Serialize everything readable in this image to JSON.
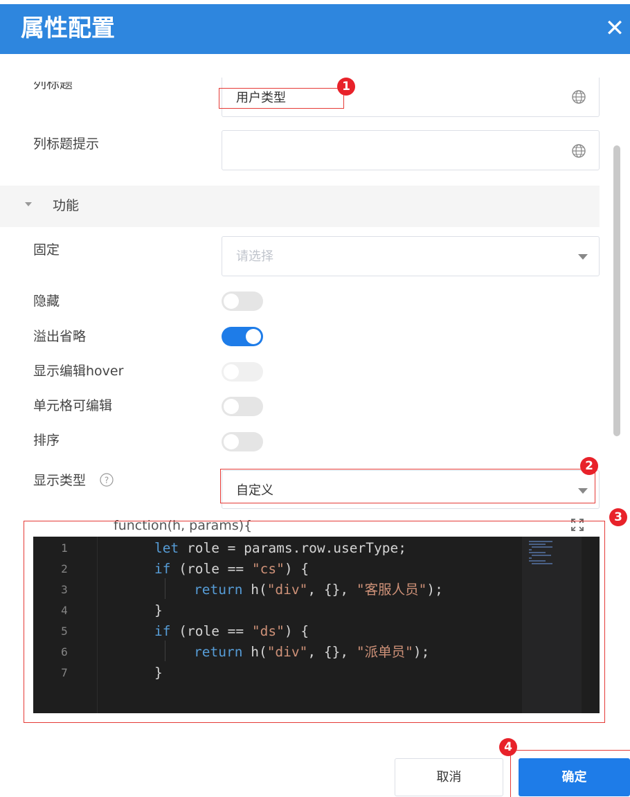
{
  "dialog": {
    "title": "属性配置"
  },
  "fields": {
    "column_title": {
      "label": "列标题",
      "value": "用户类型"
    },
    "column_title_tip": {
      "label": "列标题提示",
      "value": ""
    },
    "section_function": "功能",
    "fixed": {
      "label": "固定",
      "placeholder": "请选择"
    },
    "hidden": {
      "label": "隐藏",
      "on": false
    },
    "overflow_ellipsis": {
      "label": "溢出省略",
      "on": true
    },
    "show_edit_hover": {
      "label": "显示编辑hover",
      "on": false,
      "disabled": true
    },
    "cell_editable": {
      "label": "单元格可编辑",
      "on": false
    },
    "sort": {
      "label": "排序",
      "on": false
    },
    "display_type": {
      "label": "显示类型",
      "value": "自定义"
    }
  },
  "editor": {
    "signature": "function(h, params){",
    "line_numbers": [
      "1",
      "2",
      "3",
      "4",
      "5",
      "6",
      "7"
    ],
    "lines": [
      "let role = params.row.userType;",
      "if (role == \"cs\") {",
      "return h(\"div\", {}, \"客服人员\");",
      "}",
      "if (role == \"ds\") {",
      "return h(\"div\", {}, \"派单员\");",
      "}"
    ]
  },
  "annotations": [
    "1",
    "2",
    "3",
    "4"
  ],
  "buttons": {
    "cancel": "取消",
    "ok": "确定"
  },
  "colors": {
    "header": "#2e86de",
    "primary": "#1e7ce8",
    "annotation": "#e8222a",
    "editor_bg": "#1e1e1e"
  }
}
